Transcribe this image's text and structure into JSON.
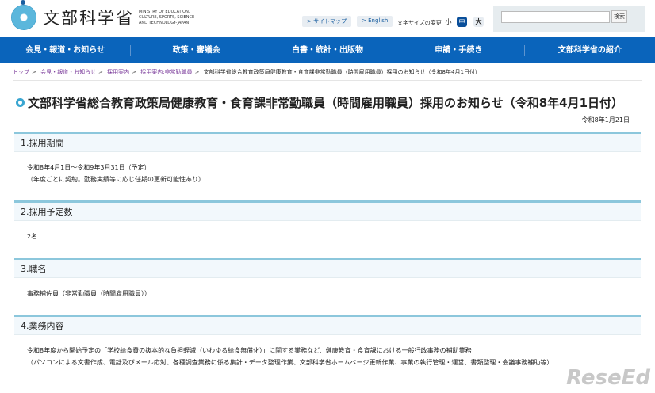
{
  "header": {
    "logo_jp": "文部科学省",
    "logo_en": "MINISTRY OF EDUCATION, CULTURE, SPORTS, SCIENCE AND TECHNOLOGY-JAPAN",
    "sitemap": "> サイトマップ",
    "english": "> English",
    "font_size_label": "文字サイズの変更",
    "font_small": "小",
    "font_medium": "中",
    "font_large": "大",
    "search_placeholder": "",
    "search_button": "検索"
  },
  "nav": [
    "会見・報道・お知らせ",
    "政策・審議会",
    "白書・統計・出版物",
    "申請・手続き",
    "文部科学省の紹介"
  ],
  "breadcrumb": [
    "トップ",
    "会見・報道・お知らせ",
    "採用案内",
    "採用案内:非常勤職員",
    "文部科学省総合教育政策局健康教育・食育課非常勤職員（時間雇用職員）採用のお知らせ（令和8年4月1日付）"
  ],
  "page": {
    "title": "文部科学省総合教育政策局健康教育・食育課非常勤職員（時間雇用職員）採用のお知らせ（令和8年4月1日付）",
    "date": "令和8年1月21日"
  },
  "sections": [
    {
      "heading": "1.採用期間",
      "lines": [
        "令和8年4月1日～令和9年3月31日（予定）",
        "（年度ごとに契約。勤務実績等に応じ任期の更新可能性あり）"
      ]
    },
    {
      "heading": "2.採用予定数",
      "lines": [
        "2名"
      ]
    },
    {
      "heading": "3.職名",
      "lines": [
        "事務補佐員（非常勤職員（時間雇用職員））"
      ]
    },
    {
      "heading": "4.業務内容",
      "lines": [
        "令和8年度から開始予定の「学校給食費の抜本的な負担軽減（いわゆる給食無償化）」に関する業務など、健康教育・食育課における一般行政事務の補助業務",
        "（パソコンによる文書作成、電話及びメール応対、各種調査業務に係る集計・データ整理作業、文部科学省ホームページ更新作業、事業の執行管理・運営、書類整理・会議事務補助等）"
      ]
    }
  ],
  "watermark": "ReseEd"
}
